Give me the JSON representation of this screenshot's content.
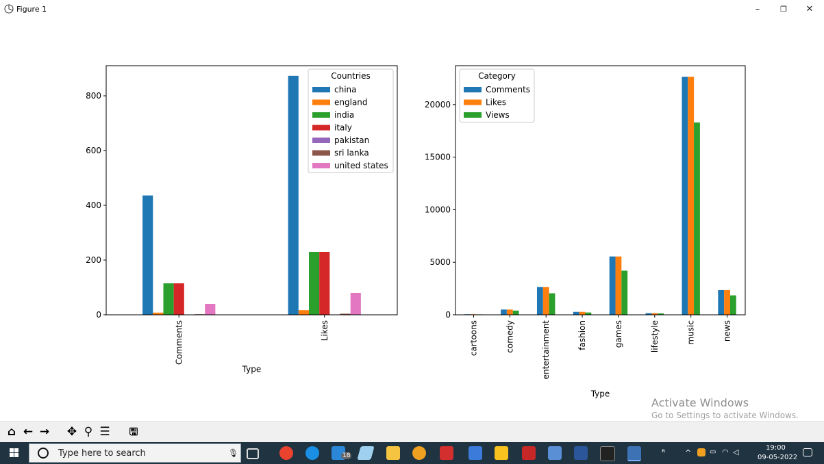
{
  "window": {
    "title": "Figure 1",
    "minimize": "–",
    "restore": "❐",
    "close": "✕"
  },
  "chart_data": [
    {
      "type": "bar",
      "categories": [
        "Comments",
        "Likes"
      ],
      "xlabel": "Type",
      "ylabel": "",
      "ylim": [
        0,
        910
      ],
      "yticks": [
        0,
        200,
        400,
        600,
        800
      ],
      "legend_title": "Countries",
      "legend_position": "top-right",
      "series": [
        {
          "name": "china",
          "color": "#1f77b4",
          "values": [
            436,
            873
          ]
        },
        {
          "name": "england",
          "color": "#ff7f0e",
          "values": [
            8,
            17
          ]
        },
        {
          "name": "india",
          "color": "#2ca02c",
          "values": [
            115,
            230
          ]
        },
        {
          "name": "italy",
          "color": "#d62728",
          "values": [
            115,
            230
          ]
        },
        {
          "name": "pakistan",
          "color": "#9467bd",
          "values": [
            1,
            1
          ]
        },
        {
          "name": "sri lanka",
          "color": "#8c564b",
          "values": [
            2,
            4
          ]
        },
        {
          "name": "united states",
          "color": "#e377c2",
          "values": [
            40,
            80
          ]
        }
      ]
    },
    {
      "type": "bar",
      "categories": [
        "cartoons",
        "comedy",
        "entertainment",
        "fashion",
        "games",
        "lifestyle",
        "music",
        "news"
      ],
      "xlabel": "Type",
      "ylabel": "",
      "ylim": [
        0,
        23700
      ],
      "yticks": [
        0,
        5000,
        10000,
        15000,
        20000
      ],
      "legend_title": "Category",
      "legend_position": "top-left",
      "series": [
        {
          "name": "Comments",
          "color": "#1f77b4",
          "values": [
            50,
            500,
            2650,
            280,
            5550,
            160,
            22650,
            2350
          ]
        },
        {
          "name": "Likes",
          "color": "#ff7f0e",
          "values": [
            50,
            500,
            2650,
            280,
            5550,
            160,
            22650,
            2350
          ]
        },
        {
          "name": "Views",
          "color": "#2ca02c",
          "values": [
            40,
            400,
            2050,
            220,
            4200,
            130,
            18300,
            1850
          ]
        }
      ]
    }
  ],
  "toolbar": {
    "home": "⌂",
    "back": "←",
    "forward": "→",
    "pan": "✥",
    "zoom": "⚲",
    "configure": "☰",
    "save": "🖫"
  },
  "watermark": {
    "line1": "Activate Windows",
    "line2": "Go to Settings to activate Windows."
  },
  "taskbar": {
    "search_placeholder": "Type here to search",
    "mail_badge": "18",
    "time": "19:00",
    "date": "09-05-2022"
  },
  "colors": {
    "taskbar": "#1f3341",
    "toolbar": "#f0f0f0"
  }
}
